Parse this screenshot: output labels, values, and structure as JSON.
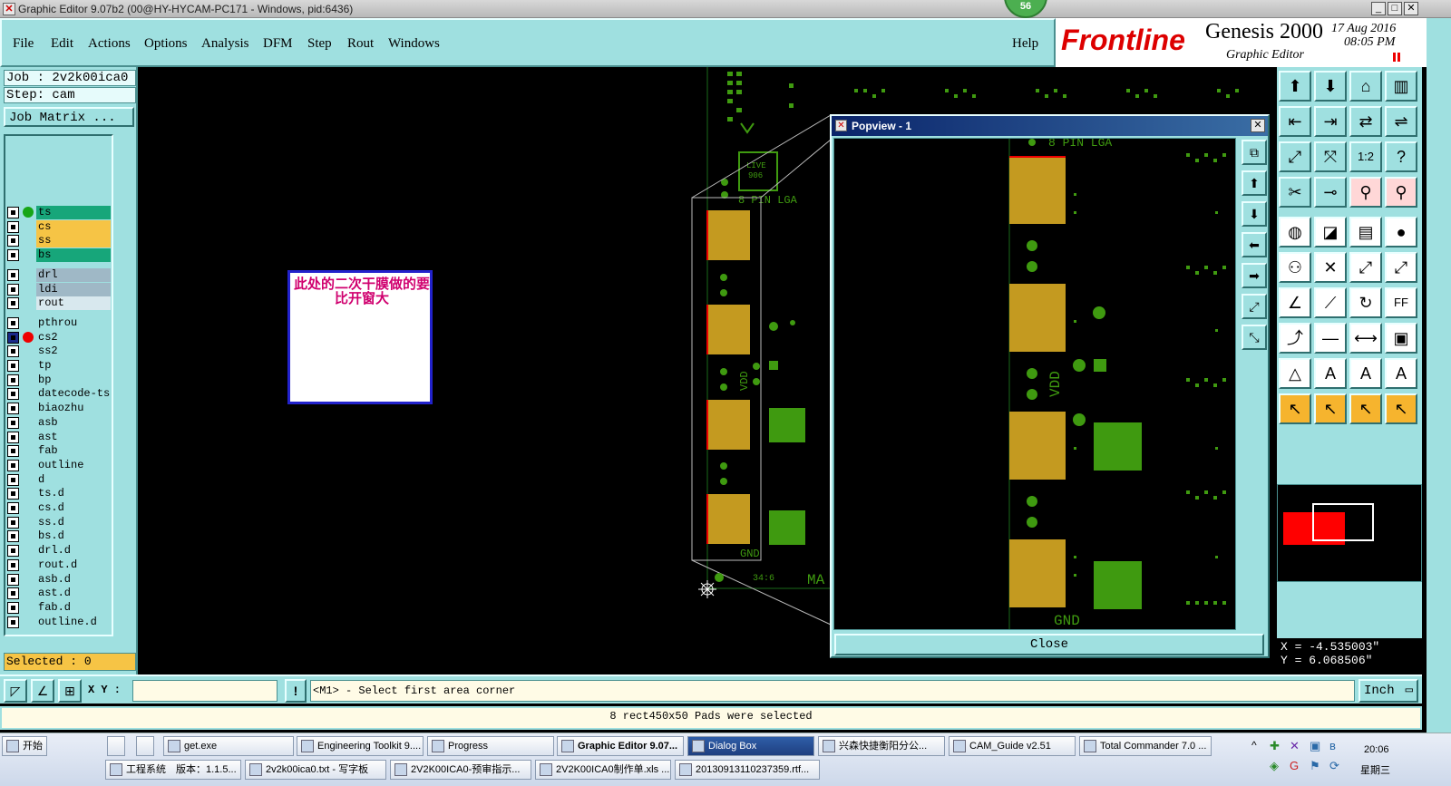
{
  "window": {
    "title": "Graphic Editor 9.07b2 (00@HY-HYCAM-PC171 - Windows, pid:6436)",
    "notification_count": "56"
  },
  "menu": {
    "items": [
      "File",
      "Edit",
      "Actions",
      "Options",
      "Analysis",
      "DFM",
      "Step",
      "Rout",
      "Windows"
    ],
    "help": "Help"
  },
  "brand": {
    "logo": "Frontline",
    "product": "Genesis 2000",
    "subtitle": "Graphic Editor",
    "date": "17 Aug 2016",
    "time": "08:05 PM"
  },
  "job": {
    "job_label": "Job : 2v2k00ica0",
    "step_label": "Step: cam",
    "job_matrix_button": "Job Matrix ...",
    "selected_label": "Selected : 0"
  },
  "layers": [
    {
      "name": "ts",
      "color": "#17a67a",
      "marker": "green"
    },
    {
      "name": "cs",
      "color": "#f6c445",
      "marker": ""
    },
    {
      "name": "ss",
      "color": "#f6c445",
      "marker": ""
    },
    {
      "name": "bs",
      "color": "#17a67a",
      "marker": ""
    },
    {
      "name": "drl",
      "color": "#9fb8c6",
      "marker": ""
    },
    {
      "name": "ldi",
      "color": "#9fb8c6",
      "marker": ""
    },
    {
      "name": "rout",
      "color": "#d8e8ee",
      "marker": ""
    },
    {
      "name": "pthrou",
      "color": "#9fe0e0",
      "marker": ""
    },
    {
      "name": "cs2",
      "color": "#9fe0e0",
      "marker": "red"
    },
    {
      "name": "ss2",
      "color": "#9fe0e0",
      "marker": ""
    },
    {
      "name": "tp",
      "color": "#9fe0e0",
      "marker": ""
    },
    {
      "name": "bp",
      "color": "#9fe0e0",
      "marker": ""
    },
    {
      "name": "datecode-ts",
      "color": "#9fe0e0",
      "marker": ""
    },
    {
      "name": "biaozhu",
      "color": "#9fe0e0",
      "marker": ""
    },
    {
      "name": "asb",
      "color": "#9fe0e0",
      "marker": ""
    },
    {
      "name": "ast",
      "color": "#9fe0e0",
      "marker": ""
    },
    {
      "name": "fab",
      "color": "#9fe0e0",
      "marker": ""
    },
    {
      "name": "outline",
      "color": "#9fe0e0",
      "marker": ""
    },
    {
      "name": "d",
      "color": "#9fe0e0",
      "marker": ""
    },
    {
      "name": "ts.d",
      "color": "#9fe0e0",
      "marker": ""
    },
    {
      "name": "cs.d",
      "color": "#9fe0e0",
      "marker": ""
    },
    {
      "name": "ss.d",
      "color": "#9fe0e0",
      "marker": ""
    },
    {
      "name": "bs.d",
      "color": "#9fe0e0",
      "marker": ""
    },
    {
      "name": "drl.d",
      "color": "#9fe0e0",
      "marker": ""
    },
    {
      "name": "rout.d",
      "color": "#9fe0e0",
      "marker": ""
    },
    {
      "name": "asb.d",
      "color": "#9fe0e0",
      "marker": ""
    },
    {
      "name": "ast.d",
      "color": "#9fe0e0",
      "marker": ""
    },
    {
      "name": "fab.d",
      "color": "#9fe0e0",
      "marker": ""
    },
    {
      "name": "outline.d",
      "color": "#9fe0e0",
      "marker": ""
    }
  ],
  "canvas": {
    "note": "此处的二次干膜做的要比开窗大",
    "labels": {
      "vdd": "VDD",
      "gnd": "GND",
      "pin_lga": "8 PIN LGA",
      "ma": "MA",
      "misc": "34:6"
    }
  },
  "popview": {
    "title": "Popview - 1",
    "close_button": "Close",
    "labels": {
      "vdd": "VDD",
      "gnd": "GND",
      "pin_lga": "8 PIN LGA"
    }
  },
  "coords": {
    "x": "X = -4.535003\"",
    "y": "Y =  6.068506\""
  },
  "command": {
    "xy_label": "X Y :",
    "xy_value": "",
    "prompt": "<M1> - Select first area corner",
    "unit": "Inch"
  },
  "status": {
    "message": "8 rect450x50 Pads were selected"
  },
  "taskbar": {
    "start": "开始",
    "row1": [
      "get.exe",
      "Engineering Toolkit 9....",
      "Progress",
      "Graphic Editor 9.07...",
      "Dialog Box",
      "兴森快捷衡阳分公...",
      "CAM_Guide v2.51",
      "Total Commander 7.0 ..."
    ],
    "row2": [
      "工程系统　版本：1.1.5...",
      "2v2k00ica0.txt - 写字板",
      "2V2K00ICA0-预审指示...",
      "2V2K00ICA0制作单.xls ...",
      "20130913110237359.rtf..."
    ],
    "clock": "20:06",
    "weekday": "星期三"
  },
  "colors": {
    "panel": "#9fe0e0",
    "pad_gold": "#c49a20",
    "pad_green": "#3f9a10",
    "accent_red": "#ff0000"
  }
}
